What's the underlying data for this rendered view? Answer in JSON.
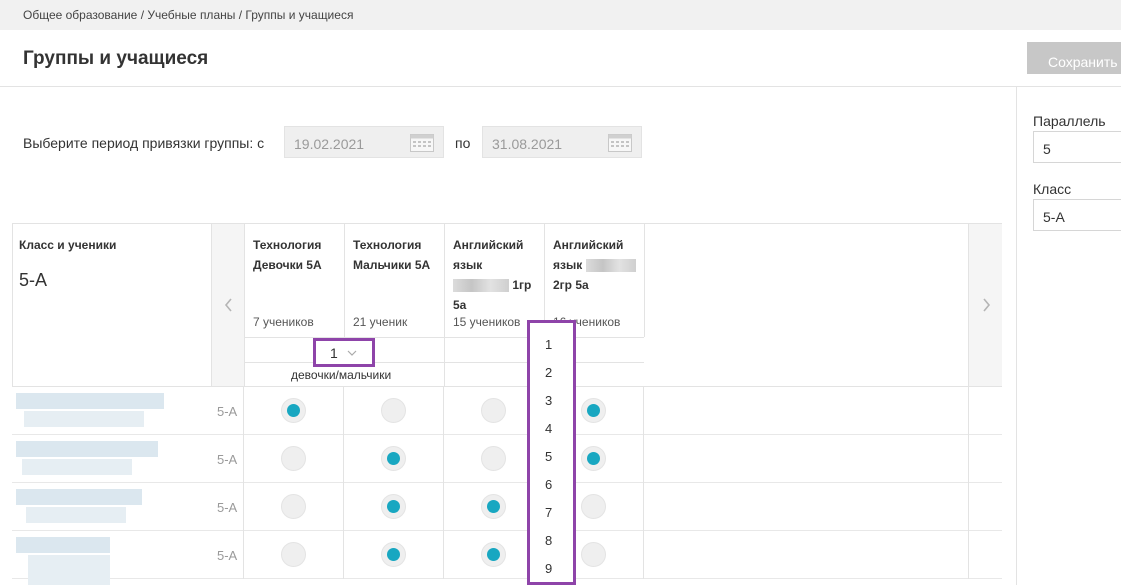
{
  "breadcrumb": {
    "items": [
      "Общее образование",
      "Учебные планы",
      "Группы и учащиеся"
    ],
    "sep": "/"
  },
  "page": {
    "title": "Группы и учащиеся",
    "save_label": "Сохранить"
  },
  "period": {
    "label": "Выберите период привязки группы: с",
    "from": "19.02.2021",
    "to_label": "по",
    "to": "31.08.2021"
  },
  "sidebar": {
    "parallel_label": "Параллель",
    "parallel_value": "5",
    "class_label": "Класс",
    "class_value": "5-А"
  },
  "grid": {
    "class_header": "Класс и ученики",
    "class_name": "5-А",
    "columns": [
      {
        "name": "Технология Девочки 5А",
        "count": "7 учеников"
      },
      {
        "name": "Технология Мальчики 5А",
        "count": "21 ученик"
      },
      {
        "name_parts": [
          "Английский язык",
          "1гр 5а"
        ],
        "count": "15 учеников"
      },
      {
        "name_parts": [
          "Английский язык",
          "2гр 5а"
        ],
        "count": "16 учеников"
      }
    ],
    "group_select_value": "1",
    "group_name": "девочки/мальчики",
    "rows": [
      {
        "class": "5-А",
        "selected": [
          true,
          false,
          false,
          true
        ]
      },
      {
        "class": "5-А",
        "selected": [
          false,
          true,
          false,
          true
        ]
      },
      {
        "class": "5-А",
        "selected": [
          false,
          true,
          true,
          false
        ]
      },
      {
        "class": "5-А",
        "selected": [
          false,
          true,
          true,
          false
        ]
      }
    ]
  },
  "dropdown": {
    "options": [
      "1",
      "2",
      "3",
      "4",
      "5",
      "6",
      "7",
      "8",
      "9"
    ]
  },
  "colors": {
    "accent": "#18a7c1",
    "highlight": "#8e44a9",
    "button_disabled": "#c7c7c7"
  }
}
